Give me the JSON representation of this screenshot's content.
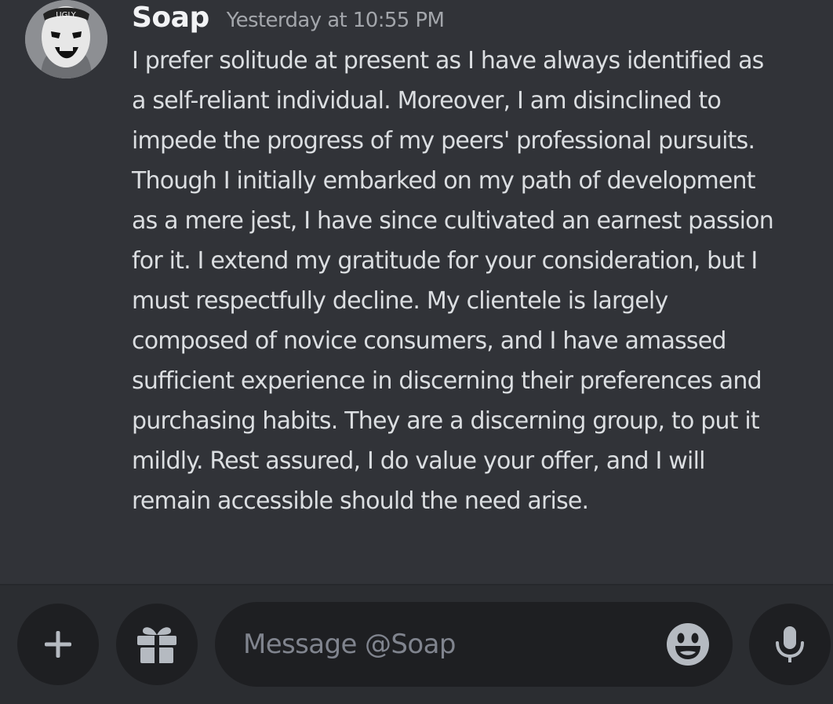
{
  "message": {
    "author": "Soap",
    "timestamp": "Yesterday at 10:55 PM",
    "avatar_icon": "ugly-mask-avatar",
    "avatar_badge_text": "UGLY",
    "lines": [
      "I prefer solitude at present as I have always identified as",
      "a self-reliant individual. Moreover, I am disinclined to",
      "impede the progress of my peers' professional pursuits.",
      "Though I initially embarked on my path of development",
      "as a mere jest, I have since cultivated an earnest passion",
      "for it. I extend my gratitude for your consideration, but I",
      "must respectfully decline. My clientele is largely",
      "composed of novice consumers, and I have amassed",
      "sufficient experience in discerning their preferences and",
      "purchasing habits. They are a discerning group, to put it",
      "mildly. Rest assured, I do value your offer, and I will",
      "remain accessible should the need arise."
    ]
  },
  "composer": {
    "placeholder": "Message @Soap",
    "value": "",
    "buttons": {
      "add": "plus-icon",
      "gift": "gift-icon",
      "emoji": "emoji-smile-icon",
      "voice": "microphone-icon"
    }
  },
  "colors": {
    "background": "#313338",
    "composer_background": "#2b2d31",
    "input_background": "#1e1f22",
    "text": "#dbdee1",
    "muted": "#a3a6ab",
    "icon": "#b5bac1"
  }
}
